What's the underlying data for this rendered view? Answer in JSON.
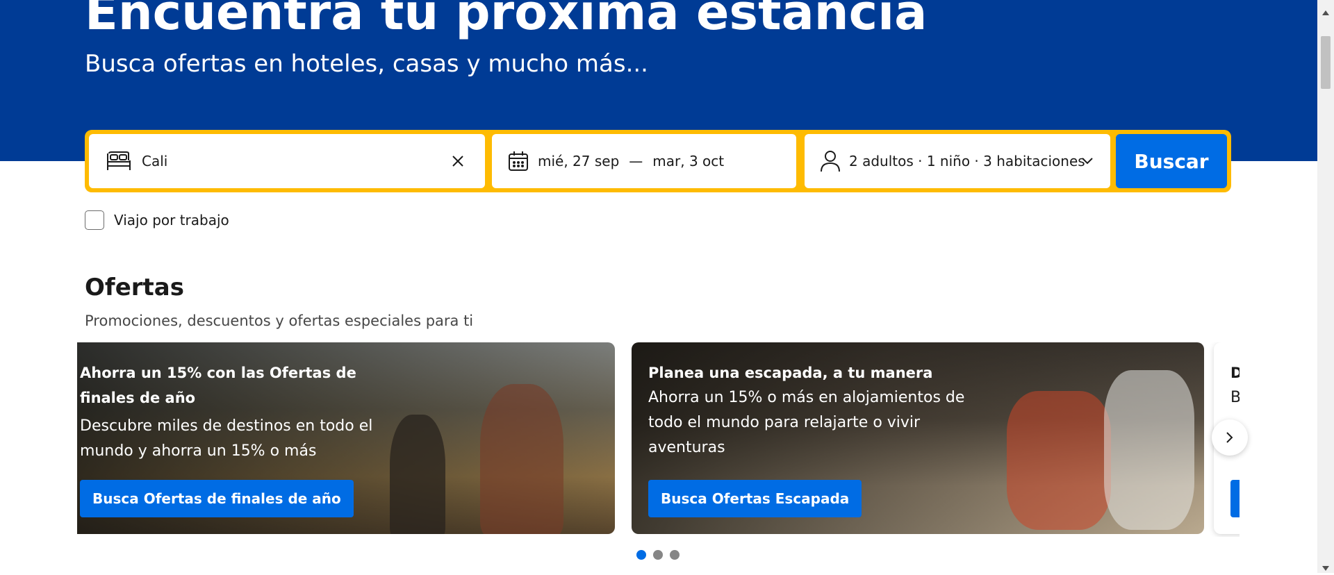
{
  "hero": {
    "title": "Encuentra tu próxima estancia",
    "subtitle": "Busca ofertas en hoteles, casas y mucho más..."
  },
  "search": {
    "destination_value": "Cali",
    "date_start": "mié, 27 sep",
    "date_separator": "—",
    "date_end": "mar, 3 oct",
    "guests": "2 adultos · 1 niño · 3 habitaciones",
    "submit_label": "Buscar",
    "business_trip_label": "Viajo por trabajo"
  },
  "offers": {
    "title": "Ofertas",
    "subtitle": "Promociones, descuentos y ofertas especiales para ti",
    "cards": [
      {
        "title": "Ahorra un 15% con las Ofertas de finales de año",
        "description": "Descubre miles de destinos en todo el mundo y ahorra un 15% o más",
        "button": "Busca Ofertas de finales de año"
      },
      {
        "title": "Planea una escapada, a tu manera",
        "description": "Ahorra un 15% o más en alojamientos de todo el mundo para relajarte o vivir aventuras",
        "button": "Busca Ofertas Escapada"
      },
      {
        "title": "D",
        "description": "B"
      }
    ],
    "carousel_dots": 3,
    "active_dot": 1
  },
  "colors": {
    "brand_blue": "#003b95",
    "action_blue": "#006ce4",
    "search_border": "#febb02"
  },
  "icons": {
    "destination": "bed-icon",
    "clear": "close-icon",
    "dates": "calendar-icon",
    "guests": "person-icon",
    "dropdown": "chevron-down-icon",
    "next": "chevron-right-icon"
  }
}
